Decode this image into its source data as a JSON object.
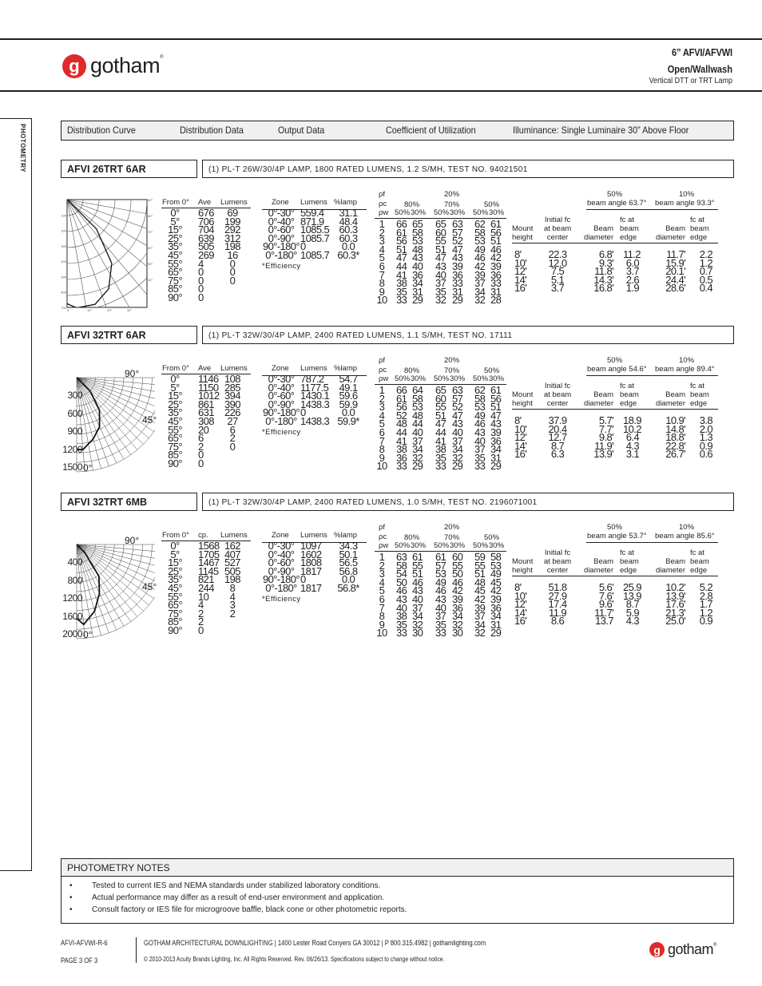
{
  "brand": {
    "name": "gotham",
    "mark": "g",
    "reg": "®",
    "color": "#e02a2a"
  },
  "header": {
    "product": "6” AFVI/AFVWI",
    "type": "Open/Wallwash",
    "lamp": "Vertical DTT or TRT Lamp"
  },
  "side_label": "PHOTOMETRY",
  "tabs": [
    "Distribution Curve",
    "Distribution Data",
    "Output Data",
    "Coefficient of Utilization",
    "Illuminance: Single Luminaire 30” Above Floor"
  ],
  "labels": {
    "from0": "From 0°",
    "lumens": "Lumens",
    "zone": "Zone",
    "pct_lamp": "%lamp",
    "efficiency": "*Efficiency",
    "pf": "ρf",
    "pc": "ρc",
    "pw": "ρw",
    "pf_val": "20%",
    "pc_vals": [
      "80%",
      "70%",
      "50%"
    ],
    "pw_vals": [
      "50%",
      "30%"
    ],
    "mount": [
      "Mount",
      "height"
    ],
    "initial": [
      "Initial  fc",
      "at beam",
      "center"
    ],
    "beam": [
      "Beam",
      "diameter"
    ],
    "fcedge": [
      "fc  at",
      "beam",
      "edge"
    ]
  },
  "sections": [
    {
      "name": "AFVI 26TRT 6AR",
      "lamp": "(1) PL-T 26W/30/4P LAMP, 1800 RATED LUMENS, 1.2 S/MH, TEST NO. 94021501",
      "dist_col2": "Ave",
      "chart_style": "grid",
      "chart_labels": {
        "radial": [
          "100",
          "200",
          "300",
          "400",
          "500",
          "600",
          "700"
        ],
        "bottom": [
          "0°",
          "10°",
          "20°",
          "30°"
        ],
        "right": [
          "90°",
          "80°",
          "70°",
          "60°",
          "50°",
          "40°"
        ]
      },
      "distribution": [
        [
          "0°",
          "676",
          ""
        ],
        [
          "5°",
          "706",
          "69"
        ],
        [
          "15°",
          "704",
          "199"
        ],
        [
          "25°",
          "639",
          "292"
        ],
        [
          "35°",
          "505",
          "312"
        ],
        [
          "45°",
          "269",
          "198"
        ],
        [
          "55°",
          "4",
          "16"
        ],
        [
          "65°",
          "0",
          "0"
        ],
        [
          "75°",
          "0",
          "0"
        ],
        [
          "85°",
          "0",
          "0"
        ],
        [
          "90°",
          "0",
          ""
        ]
      ],
      "output": [
        [
          "0°-30°",
          "559.4",
          "31.1"
        ],
        [
          "0°-40°",
          "871.9",
          "48.4"
        ],
        [
          "0°-60°",
          "1085.5",
          "60.3"
        ],
        [
          "0°-90°",
          "1085.7",
          "60.3"
        ],
        [
          "90°-180°",
          "0",
          "0.0"
        ],
        [
          "0°-180°",
          "1085.7",
          "60.3*"
        ]
      ],
      "cu": [
        [
          1,
          66,
          65,
          65,
          63,
          62,
          61
        ],
        [
          2,
          61,
          58,
          60,
          57,
          58,
          56
        ],
        [
          3,
          56,
          53,
          55,
          52,
          53,
          51
        ],
        [
          4,
          51,
          48,
          51,
          47,
          49,
          46
        ],
        [
          5,
          47,
          43,
          47,
          43,
          46,
          42
        ],
        [
          6,
          44,
          40,
          43,
          39,
          42,
          39
        ],
        [
          7,
          41,
          36,
          40,
          36,
          39,
          36
        ],
        [
          8,
          38,
          34,
          37,
          33,
          37,
          33
        ],
        [
          9,
          35,
          31,
          35,
          31,
          34,
          31
        ],
        [
          10,
          33,
          29,
          32,
          29,
          32,
          28
        ]
      ],
      "beam50": {
        "pct": "50%",
        "angle": "beam angle 63.7°"
      },
      "beam10": {
        "pct": "10%",
        "angle": "beam angle 93.3°"
      },
      "illum": [
        [
          "8'",
          "22.3",
          "6.8'",
          "11.2",
          "11.7'",
          "2.2"
        ],
        [
          "10'",
          "12.0",
          "9.3'",
          "6.0",
          "15.9'",
          "1.2"
        ],
        [
          "12'",
          "7.5",
          "11.8'",
          "3.7",
          "20.1'",
          "0.7"
        ],
        [
          "14'",
          "5.1",
          "14.3'",
          "2.6",
          "24.4'",
          "0.5"
        ],
        [
          "16'",
          "3.7",
          "16.8'",
          "1.9",
          "28.6'",
          "0.4"
        ]
      ]
    },
    {
      "name": "AFVI 32TRT 6AR",
      "lamp": "(1) PL-T 32W/30/4P LAMP, 2400 RATED LUMENS, 1.1 S/MH, TEST NO. 17111",
      "dist_col2": "Ave",
      "chart_style": "fan",
      "chart_labels": {
        "radial": [
          "300",
          "600",
          "900",
          "1200",
          "1500"
        ],
        "a90": "90°",
        "a45": "45°",
        "a0": "0°"
      },
      "distribution": [
        [
          "0°",
          "1146",
          ""
        ],
        [
          "5°",
          "1150",
          "108"
        ],
        [
          "15°",
          "1012",
          "285"
        ],
        [
          "25°",
          "861",
          "394"
        ],
        [
          "35°",
          "631",
          "390"
        ],
        [
          "45°",
          "308",
          "226"
        ],
        [
          "55°",
          "20",
          "27"
        ],
        [
          "65°",
          "6",
          "6"
        ],
        [
          "75°",
          "2",
          "2"
        ],
        [
          "85°",
          "0",
          "0"
        ],
        [
          "90°",
          "0",
          ""
        ]
      ],
      "output": [
        [
          "0°-30°",
          "787.2",
          "54.7"
        ],
        [
          "0°-40°",
          "1177.5",
          "49.1"
        ],
        [
          "0°-60°",
          "1430.1",
          "59.6"
        ],
        [
          "0°-90°",
          "1438.3",
          "59.9"
        ],
        [
          "90°-180°",
          "0",
          "0.0"
        ],
        [
          "0°-180°",
          "1438.3",
          "59.9*"
        ]
      ],
      "cu": [
        [
          1,
          66,
          64,
          65,
          63,
          62,
          61
        ],
        [
          2,
          61,
          58,
          60,
          57,
          58,
          56
        ],
        [
          3,
          56,
          53,
          55,
          52,
          53,
          51
        ],
        [
          4,
          52,
          48,
          51,
          47,
          49,
          47
        ],
        [
          5,
          48,
          44,
          47,
          43,
          46,
          43
        ],
        [
          6,
          44,
          40,
          44,
          40,
          43,
          39
        ],
        [
          7,
          41,
          37,
          41,
          37,
          40,
          36
        ],
        [
          8,
          38,
          34,
          38,
          34,
          37,
          34
        ],
        [
          9,
          36,
          32,
          35,
          32,
          35,
          31
        ],
        [
          10,
          33,
          29,
          33,
          29,
          33,
          29
        ]
      ],
      "beam50": {
        "pct": "50%",
        "angle": "beam angle 54.6°"
      },
      "beam10": {
        "pct": "10%",
        "angle": "beam angle 89.4°"
      },
      "illum": [
        [
          "8'",
          "37.9",
          "5.7'",
          "18.9",
          "10.9'",
          "3.8"
        ],
        [
          "10'",
          "20.4",
          "7.7'",
          "10.2",
          "14.8'",
          "2.0"
        ],
        [
          "12'",
          "12.7",
          "9.8'",
          "6.4",
          "18.8'",
          "1.3"
        ],
        [
          "14'",
          "8.7",
          "11.9'",
          "4.3",
          "22.8'",
          "0.9"
        ],
        [
          "16'",
          "6.3",
          "13.9'",
          "3.1",
          "26.7'",
          "0.6"
        ]
      ]
    },
    {
      "name": "AFVI 32TRT 6MB",
      "lamp": "(1) PL-T 32W/30/4P LAMP, 2400 RATED LUMENS, 1.0 S/MH, TEST NO. 2196071001",
      "dist_col2": "cp.",
      "chart_style": "fan",
      "chart_labels": {
        "radial": [
          "400",
          "800",
          "1200",
          "1600",
          "2000"
        ],
        "a90": "90°",
        "a45": "45°",
        "a0": "0°"
      },
      "distribution": [
        [
          "0°",
          "1568",
          ""
        ],
        [
          "5°",
          "1705",
          "162"
        ],
        [
          "15°",
          "1467",
          "407"
        ],
        [
          "25°",
          "1145",
          "527"
        ],
        [
          "35°",
          "821",
          "505"
        ],
        [
          "45°",
          "244",
          "198"
        ],
        [
          "55°",
          "10",
          "8"
        ],
        [
          "65°",
          "4",
          "4"
        ],
        [
          "75°",
          "2",
          "3"
        ],
        [
          "85°",
          "2",
          "2"
        ],
        [
          "90°",
          "0",
          ""
        ]
      ],
      "output": [
        [
          "0°-30°",
          "1097",
          "34.3"
        ],
        [
          "0°-40°",
          "1602",
          "50.1"
        ],
        [
          "0°-60°",
          "1808",
          "56.5"
        ],
        [
          "0°-90°",
          "1817",
          "56.8"
        ],
        [
          "90°-180°",
          "0",
          "0.0"
        ],
        [
          "0°-180°",
          "1817",
          "56.8*"
        ]
      ],
      "cu": [
        [
          1,
          63,
          61,
          61,
          60,
          59,
          58
        ],
        [
          2,
          58,
          55,
          57,
          55,
          55,
          53
        ],
        [
          3,
          54,
          51,
          53,
          50,
          51,
          49
        ],
        [
          4,
          50,
          46,
          49,
          46,
          48,
          45
        ],
        [
          5,
          46,
          43,
          46,
          42,
          45,
          42
        ],
        [
          6,
          43,
          40,
          43,
          39,
          42,
          39
        ],
        [
          7,
          40,
          37,
          40,
          36,
          39,
          36
        ],
        [
          8,
          38,
          34,
          37,
          34,
          37,
          34
        ],
        [
          9,
          35,
          32,
          35,
          32,
          34,
          31
        ],
        [
          10,
          33,
          30,
          33,
          30,
          32,
          29
        ]
      ],
      "beam50": {
        "pct": "50%",
        "angle": "beam angle 53.7°"
      },
      "beam10": {
        "pct": "10%",
        "angle": "beam angle 85.6°"
      },
      "illum": [
        [
          "8'",
          "51.8",
          "5.6'",
          "25.9",
          "10.2'",
          "5.2"
        ],
        [
          "10'",
          "27.9",
          "7.6'",
          "13.9",
          "13.9'",
          "2.8"
        ],
        [
          "12'",
          "17.4",
          "9.6'",
          "8.7",
          "17.6'",
          "1.7"
        ],
        [
          "14'",
          "11.9",
          "11.7'",
          "5.9",
          "21.3'",
          "1.2"
        ],
        [
          "16'",
          "8.6",
          "13.7",
          "4.3",
          "25.0'",
          "0.9"
        ]
      ]
    }
  ],
  "notes": {
    "title": "PHOTOMETRY NOTES",
    "items": [
      "Tested to current IES and NEMA standards under stabilized laboratory conditions.",
      "Actual performance may differ as a result of end-user environment and application.",
      "Consult factory or IES file for microgroove baffle, black cone or other photometric reports."
    ]
  },
  "footer": {
    "doc_id": "AFVI-AFVWI-R-6",
    "page": "PAGE 3 OF 3",
    "company": "GOTHAM ARCHITECTURAL DOWNLIGHTING  |  1400 Lester Road Conyers GA 30012  |  P 800.315.4982  |  gothamlighting.com",
    "copyright": "© 2010-2013 Acuity Brands Lighting, Inc. All Rights Reserved. Rev. 06/26/13. Specifications subject to change without notice."
  }
}
